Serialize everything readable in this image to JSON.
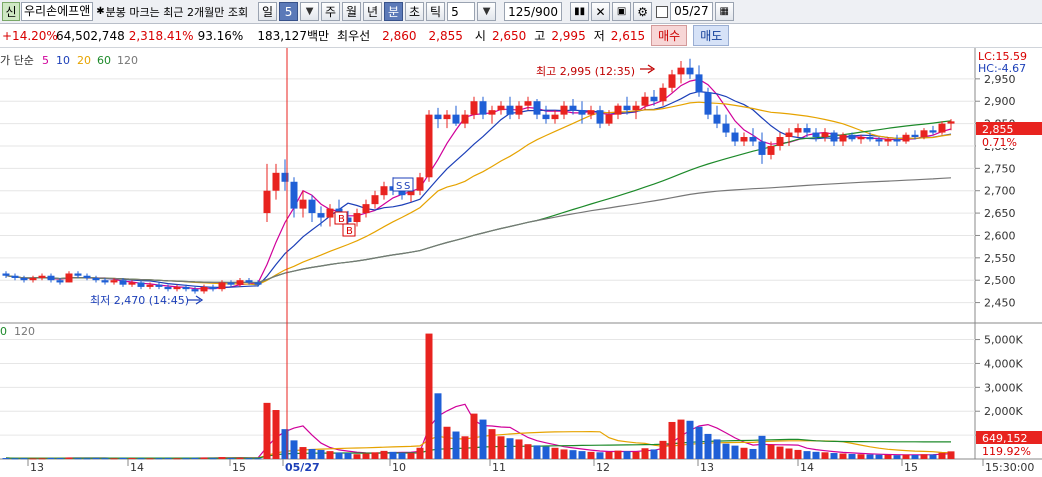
{
  "toolbar": {
    "stock_badge": "신",
    "stock_name": "우리손에프앤",
    "dot_note": "분봉 마크는 최근 2개월만 조회",
    "period_selected": "일",
    "period_value": "5",
    "periods": [
      "주",
      "월",
      "년",
      "분",
      "초",
      "틱"
    ],
    "tick_value": "5",
    "count": "125/900",
    "date": "05/27"
  },
  "info": {
    "change_pct": "+14.20%",
    "volume": "64,502,748",
    "amount_pct": "2,318.41%",
    "ratio": "93.16%",
    "amount": "183,127백만",
    "best_label": "최우선",
    "best_sell": "2,860",
    "best_buy": "2,855",
    "open_label": "시",
    "open": "2,650",
    "high_label": "고",
    "high": "2,995",
    "low_label": "저",
    "low": "2,615",
    "buy_label": "매수",
    "sell_label": "매도"
  },
  "legend": {
    "prefix": "가 단순",
    "ma": [
      {
        "label": "5",
        "color": "#d0009a"
      },
      {
        "label": "10",
        "color": "#1c3fb8"
      },
      {
        "label": "20",
        "color": "#e6a300"
      },
      {
        "label": "60",
        "color": "#1d8a2a"
      },
      {
        "label": "120",
        "color": "#777777"
      }
    ]
  },
  "volume_legend": {
    "prefix": "0",
    "label": "120"
  },
  "annotations": {
    "high": "최고 2,995 (12:35)",
    "low": "최저 2,470 (14:45)",
    "lc": "LC:15.59",
    "hc": "HC:-4.67",
    "price_tag": "2,855",
    "pct_tag": "0.71%",
    "vol_tag": "649,152",
    "vol_pct_tag": "119.92%",
    "marker_b1": "B",
    "marker_b2": "B",
    "marker_s1": "S",
    "marker_s2": "S"
  },
  "x_labels": [
    "13",
    "14",
    "15",
    "05/27",
    "10",
    "11",
    "12",
    "13",
    "14",
    "15",
    "15:30:00"
  ],
  "colors": {
    "up": "#e8231f",
    "down": "#1f5fd6",
    "ma5": "#d0009a",
    "ma10": "#1c3fb8",
    "ma20": "#e6a300",
    "ma60": "#1d8a2a",
    "ma120": "#777777"
  },
  "chart_data": {
    "type": "candlestick",
    "price_axis": {
      "ticks": [
        2450,
        2500,
        2550,
        2600,
        2650,
        2700,
        2750,
        2800,
        2850,
        2900,
        2950
      ],
      "range": [
        2420,
        3010
      ]
    },
    "volume_axis": {
      "ticks": [
        "1,000K",
        "2,000K",
        "3,000K",
        "4,000K",
        "5,000K"
      ],
      "range": [
        0,
        5400
      ]
    },
    "candles": [
      [
        2515,
        2520,
        2505,
        2510,
        40
      ],
      [
        2510,
        2515,
        2500,
        2505,
        30
      ],
      [
        2505,
        2510,
        2495,
        2500,
        35
      ],
      [
        2500,
        2510,
        2495,
        2505,
        25
      ],
      [
        2505,
        2515,
        2500,
        2510,
        30
      ],
      [
        2510,
        2515,
        2495,
        2500,
        45
      ],
      [
        2500,
        2505,
        2490,
        2495,
        40
      ],
      [
        2495,
        2520,
        2495,
        2515,
        60
      ],
      [
        2515,
        2520,
        2505,
        2510,
        35
      ],
      [
        2510,
        2515,
        2500,
        2505,
        30
      ],
      [
        2505,
        2510,
        2495,
        2500,
        40
      ],
      [
        2500,
        2505,
        2490,
        2495,
        35
      ],
      [
        2495,
        2505,
        2490,
        2500,
        30
      ],
      [
        2500,
        2505,
        2485,
        2490,
        45
      ],
      [
        2490,
        2500,
        2485,
        2495,
        40
      ],
      [
        2495,
        2500,
        2480,
        2485,
        35
      ],
      [
        2485,
        2495,
        2480,
        2490,
        30
      ],
      [
        2490,
        2495,
        2480,
        2485,
        35
      ],
      [
        2485,
        2490,
        2475,
        2480,
        40
      ],
      [
        2480,
        2490,
        2475,
        2485,
        30
      ],
      [
        2485,
        2490,
        2475,
        2480,
        35
      ],
      [
        2480,
        2485,
        2470,
        2475,
        45
      ],
      [
        2475,
        2490,
        2470,
        2485,
        60
      ],
      [
        2485,
        2490,
        2475,
        2480,
        35
      ],
      [
        2480,
        2500,
        2475,
        2495,
        80
      ],
      [
        2495,
        2500,
        2485,
        2490,
        40
      ],
      [
        2490,
        2505,
        2485,
        2500,
        50
      ],
      [
        2500,
        2505,
        2490,
        2495,
        35
      ],
      [
        2495,
        2500,
        2485,
        2490,
        30
      ],
      [
        2650,
        2760,
        2630,
        2700,
        2350
      ],
      [
        2700,
        2760,
        2680,
        2740,
        2050
      ],
      [
        2740,
        2770,
        2700,
        2720,
        1250
      ],
      [
        2720,
        2730,
        2640,
        2660,
        780
      ],
      [
        2660,
        2700,
        2640,
        2680,
        500
      ],
      [
        2680,
        2690,
        2630,
        2650,
        420
      ],
      [
        2650,
        2665,
        2620,
        2640,
        380
      ],
      [
        2640,
        2670,
        2620,
        2660,
        330
      ],
      [
        2660,
        2680,
        2630,
        2640,
        270
      ],
      [
        2640,
        2655,
        2610,
        2630,
        250
      ],
      [
        2630,
        2660,
        2620,
        2650,
        200
      ],
      [
        2650,
        2680,
        2640,
        2670,
        230
      ],
      [
        2670,
        2700,
        2660,
        2690,
        280
      ],
      [
        2690,
        2720,
        2680,
        2710,
        340
      ],
      [
        2710,
        2730,
        2690,
        2700,
        300
      ],
      [
        2700,
        2715,
        2680,
        2690,
        260
      ],
      [
        2690,
        2710,
        2675,
        2700,
        250
      ],
      [
        2700,
        2740,
        2690,
        2730,
        470
      ],
      [
        2730,
        2880,
        2720,
        2870,
        5250
      ],
      [
        2870,
        2885,
        2840,
        2860,
        2750
      ],
      [
        2860,
        2880,
        2840,
        2870,
        1350
      ],
      [
        2870,
        2890,
        2845,
        2850,
        1150
      ],
      [
        2850,
        2880,
        2840,
        2870,
        950
      ],
      [
        2870,
        2910,
        2860,
        2900,
        1900
      ],
      [
        2900,
        2910,
        2860,
        2870,
        1650
      ],
      [
        2870,
        2890,
        2850,
        2880,
        1250
      ],
      [
        2880,
        2900,
        2870,
        2890,
        950
      ],
      [
        2890,
        2910,
        2860,
        2870,
        870
      ],
      [
        2870,
        2900,
        2860,
        2890,
        820
      ],
      [
        2890,
        2910,
        2880,
        2900,
        620
      ],
      [
        2900,
        2905,
        2860,
        2870,
        570
      ],
      [
        2870,
        2890,
        2850,
        2860,
        520
      ],
      [
        2860,
        2880,
        2850,
        2870,
        470
      ],
      [
        2870,
        2900,
        2860,
        2890,
        400
      ],
      [
        2890,
        2905,
        2870,
        2880,
        370
      ],
      [
        2880,
        2900,
        2850,
        2870,
        330
      ],
      [
        2870,
        2890,
        2860,
        2880,
        300
      ],
      [
        2880,
        2890,
        2840,
        2850,
        280
      ],
      [
        2850,
        2880,
        2845,
        2870,
        300
      ],
      [
        2870,
        2895,
        2860,
        2890,
        350
      ],
      [
        2890,
        2910,
        2870,
        2880,
        330
      ],
      [
        2880,
        2900,
        2860,
        2890,
        300
      ],
      [
        2890,
        2920,
        2880,
        2910,
        450
      ],
      [
        2910,
        2925,
        2890,
        2900,
        400
      ],
      [
        2900,
        2940,
        2890,
        2930,
        760
      ],
      [
        2930,
        2970,
        2920,
        2960,
        1550
      ],
      [
        2960,
        2990,
        2940,
        2975,
        1650
      ],
      [
        2975,
        2995,
        2950,
        2960,
        1600
      ],
      [
        2960,
        2980,
        2910,
        2920,
        1350
      ],
      [
        2920,
        2930,
        2860,
        2870,
        1050
      ],
      [
        2870,
        2890,
        2840,
        2850,
        820
      ],
      [
        2850,
        2870,
        2820,
        2830,
        640
      ],
      [
        2830,
        2840,
        2800,
        2810,
        560
      ],
      [
        2810,
        2830,
        2800,
        2820,
        470
      ],
      [
        2820,
        2840,
        2800,
        2810,
        420
      ],
      [
        2810,
        2830,
        2760,
        2780,
        970
      ],
      [
        2780,
        2810,
        2770,
        2800,
        600
      ],
      [
        2800,
        2830,
        2790,
        2820,
        520
      ],
      [
        2820,
        2840,
        2800,
        2830,
        440
      ],
      [
        2830,
        2850,
        2820,
        2840,
        380
      ],
      [
        2840,
        2850,
        2820,
        2830,
        330
      ],
      [
        2830,
        2840,
        2810,
        2820,
        300
      ],
      [
        2820,
        2840,
        2810,
        2830,
        280
      ],
      [
        2830,
        2835,
        2800,
        2810,
        250
      ],
      [
        2810,
        2830,
        2800,
        2825,
        230
      ],
      [
        2825,
        2830,
        2810,
        2815,
        210
      ],
      [
        2815,
        2825,
        2805,
        2820,
        200
      ],
      [
        2820,
        2830,
        2810,
        2815,
        190
      ],
      [
        2815,
        2820,
        2800,
        2810,
        180
      ],
      [
        2810,
        2820,
        2800,
        2815,
        170
      ],
      [
        2815,
        2825,
        2800,
        2810,
        160
      ],
      [
        2810,
        2830,
        2805,
        2825,
        180
      ],
      [
        2825,
        2835,
        2815,
        2820,
        170
      ],
      [
        2820,
        2840,
        2815,
        2835,
        200
      ],
      [
        2835,
        2845,
        2825,
        2830,
        190
      ],
      [
        2830,
        2855,
        2825,
        2850,
        260
      ],
      [
        2850,
        2860,
        2835,
        2855,
        320
      ]
    ]
  }
}
